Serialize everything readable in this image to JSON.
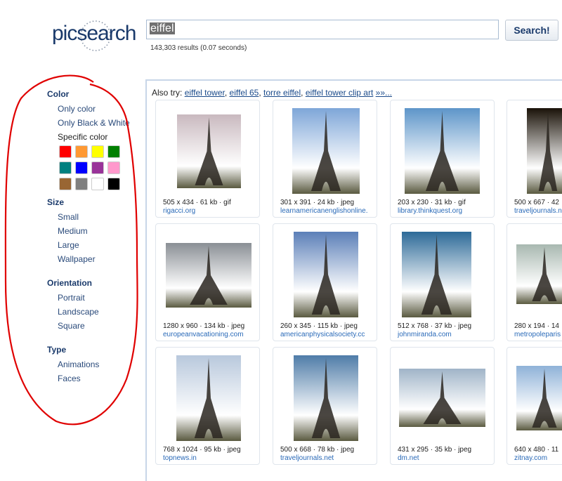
{
  "logo": {
    "text": "picsearch"
  },
  "search": {
    "query": "eiffel",
    "button": "Search!",
    "results": "143,303 results (0.07 seconds)"
  },
  "sidebar": {
    "color_title": "Color",
    "only_color": "Only color",
    "only_bw": "Only Black & White",
    "specific": "Specific color",
    "swatches": [
      "#ff0000",
      "#ff9933",
      "#ffff00",
      "#008000",
      "#008080",
      "#0000ff",
      "#993399",
      "#ff99cc",
      "#996633",
      "#808080",
      "#ffffff",
      "#000000"
    ],
    "size_title": "Size",
    "sizes": [
      "Small",
      "Medium",
      "Large",
      "Wallpaper"
    ],
    "orientation_title": "Orientation",
    "orientations": [
      "Portrait",
      "Landscape",
      "Square"
    ],
    "type_title": "Type",
    "types": [
      "Animations",
      "Faces"
    ]
  },
  "also_try": {
    "label": "Also try:",
    "links": [
      "eiffel tower",
      "eiffel 65",
      "torre eiffel",
      "eiffel tower clip art"
    ],
    "more": "»»..."
  },
  "annotation_color": "#e00000",
  "results_grid": [
    {
      "meta": "505 x 434 · 61 kb · gif",
      "source": "rigacci.org",
      "sky": "#c9b9bf"
    },
    {
      "meta": "301 x 391 · 24 kb · jpeg",
      "source": "learnamericanenglishonline.",
      "sky": "#7ea6d8"
    },
    {
      "meta": "203 x 230 · 31 kb · gif",
      "source": "library.thinkquest.org",
      "sky": "#5d95c9"
    },
    {
      "meta": "500 x 667 · 42",
      "source": "traveljournals.n",
      "sky": "#1a1208"
    },
    {
      "meta": "1280 x 960 · 134 kb · jpeg",
      "source": "europeanvacationing.com",
      "sky": "#8a8f95"
    },
    {
      "meta": "260 x 345 · 115 kb · jpeg",
      "source": "americanphysicalsociety.cc",
      "sky": "#5b7fb8"
    },
    {
      "meta": "512 x 768 · 37 kb · jpeg",
      "source": "johnmiranda.com",
      "sky": "#2d6a98"
    },
    {
      "meta": "280 x 194 · 14",
      "source": "metropoleparis",
      "sky": "#a8b8b0"
    },
    {
      "meta": "768 x 1024 · 95 kb · jpeg",
      "source": "topnews.in",
      "sky": "#b8c8dc"
    },
    {
      "meta": "500 x 668 · 78 kb · jpeg",
      "source": "traveljournals.net",
      "sky": "#4f7ca8"
    },
    {
      "meta": "431 x 295 · 35 kb · jpeg",
      "source": "dm.net",
      "sky": "#a0b4c8"
    },
    {
      "meta": "640 x 480 · 11",
      "source": "zitnay.com",
      "sky": "#8fb2d8"
    }
  ]
}
